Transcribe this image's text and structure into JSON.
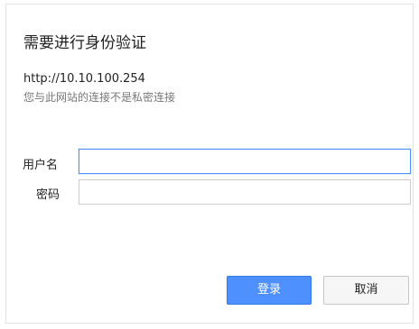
{
  "dialog": {
    "title": "需要进行身份验证",
    "url": "http://10.10.100.254",
    "note": "您与此网站的连接不是私密连接",
    "fields": {
      "username": {
        "label": "用户名",
        "value": ""
      },
      "password": {
        "label": "密码",
        "value": ""
      }
    },
    "buttons": {
      "login": "登录",
      "cancel": "取消"
    }
  },
  "colors": {
    "primary": "#4d90fe",
    "border": "#cccccc",
    "text": "#202020"
  }
}
